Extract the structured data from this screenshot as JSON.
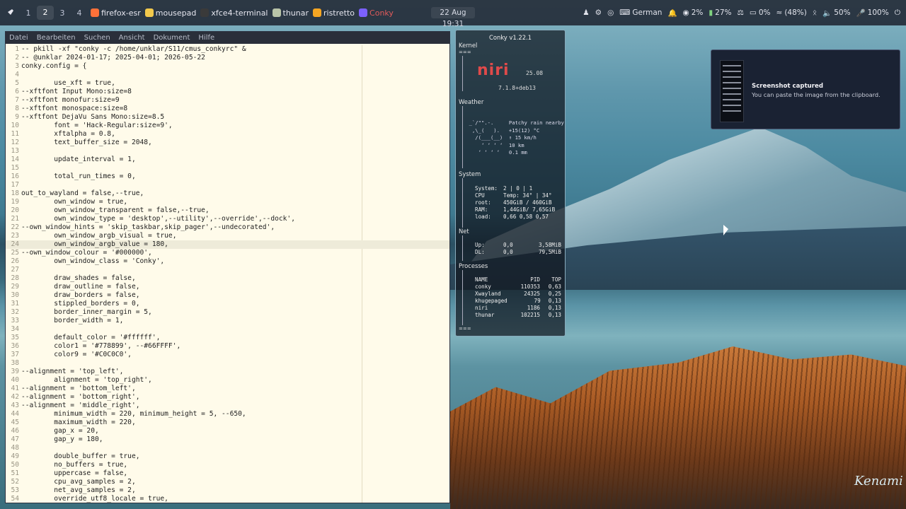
{
  "topbar": {
    "workspaces": [
      "1",
      "2",
      "3",
      "4"
    ],
    "active_workspace": "2",
    "apps": [
      {
        "label": "firefox-esr",
        "icon": "firefox-icon",
        "color": "#ff7139"
      },
      {
        "label": "mousepad",
        "icon": "mousepad-icon",
        "color": "#f2c94c"
      },
      {
        "label": "xfce4-terminal",
        "icon": "terminal-icon",
        "color": "#3a3a3a"
      },
      {
        "label": "thunar",
        "icon": "folder-icon",
        "color": "#b9c4a8"
      },
      {
        "label": "ristretto",
        "icon": "image-viewer-icon",
        "color": "#f5a623"
      },
      {
        "label": "Conky",
        "icon": "conky-icon",
        "color": "#7b61ff",
        "text_color": "#e05a5a"
      }
    ],
    "clock": "22 Aug 19:31",
    "tray": {
      "keyboard_layout": "German",
      "cpu": "2%",
      "battery": "27%",
      "backlight": "0%",
      "wifi": "(48%)",
      "volume": "50%",
      "mic": "100%"
    }
  },
  "editor": {
    "menu": [
      "Datei",
      "Bearbeiten",
      "Suchen",
      "Ansicht",
      "Dokument",
      "Hilfe"
    ],
    "highlight_line": 24,
    "lines": [
      "-- pkill -xf \"conky -c /home/unklar/S11/cmus_conkyrc\" &",
      "-- @unklar 2024-01-17; 2025-04-01; 2026-05-22",
      "conky.config = {",
      "",
      "        use_xft = true,",
      "--xftfont Input Mono:size=8",
      "--xftfont monofur:size=9",
      "--xftfont monospace:size=8",
      "--xftfont DejaVu Sans Mono:size=8.5",
      "        font = 'Hack-Regular:size=9',",
      "        xftalpha = 0.8,",
      "        text_buffer_size = 2048,",
      "",
      "        update_interval = 1,",
      "",
      "        total_run_times = 0,",
      "",
      "out_to_wayland = false,--true,",
      "        own_window = true,",
      "        own_window_transparent = false,--true,",
      "        own_window_type = 'desktop',--utility',--override',--dock',",
      "--own_window_hints = 'skip_taskbar,skip_pager',--undecorated',",
      "        own_window_argb_visual = true,",
      "        own_window_argb_value = 180,",
      "--own_window_colour = '#000000',",
      "        own_window_class = 'Conky',",
      "",
      "        draw_shades = false,",
      "        draw_outline = false,",
      "        draw_borders = false,",
      "        stippled_borders = 0,",
      "        border_inner_margin = 5,",
      "        border_width = 1,",
      "",
      "        default_color = '#ffffff',",
      "        color1 = '#778899', --#66FFFF',",
      "        color9 = '#C0C0C0',",
      "",
      "--alignment = 'top_left',",
      "        alignment = 'top_right',",
      "--alignment = 'bottom_left',",
      "--alignment = 'bottom_right',",
      "--alignment = 'middle_right',",
      "        minimum_width = 220, minimum_height = 5, --650,",
      "        maximum_width = 220,",
      "        gap_x = 20,",
      "        gap_y = 180,",
      "",
      "        double_buffer = true,",
      "        no_buffers = true,",
      "        uppercase = false,",
      "        cpu_avg_samples = 2,",
      "        net_avg_samples = 2,",
      "        override_utf8_locale = true,"
    ]
  },
  "conky": {
    "title": "Conky v1.22.1",
    "sections": {
      "kernel": "Kernel",
      "weather": "Weather",
      "system": "System",
      "net": "Net",
      "processes": "Processes"
    },
    "kernel_rule": "===",
    "logo_text": "niri",
    "niri_version": "25.08",
    "kernel_version": "7.1.8+deb13",
    "weather": [
      "  _`/\"\".-.     Patchy rain nearby",
      "   ,\\_(   ).   +15(12) °C",
      "    /(___(__)  ↑ 15 km/h",
      "      ‘ ‘ ‘ ‘  10 km",
      "     ‘ ‘ ‘ ‘   0.1 mm"
    ],
    "system": [
      [
        "System:",
        "2 | 0 | 1",
        ""
      ],
      [
        "CPU",
        "Temp: 34° | 34°",
        ""
      ],
      [
        "root:",
        "450GiB / 460GiB",
        ""
      ],
      [
        "RAM:",
        "1,44GiB/ 7,65GiB",
        ""
      ],
      [
        "load:",
        "0,66 0,58 0,57",
        ""
      ]
    ],
    "net": [
      [
        "Up:",
        "0,0",
        "3,58MiB"
      ],
      [
        "DL:",
        "0,0",
        "79,5MiB"
      ]
    ],
    "process_header": [
      "NAME",
      "PID",
      "TOP"
    ],
    "processes": [
      [
        "conky",
        "110353",
        "0,63"
      ],
      [
        "Xwayland",
        "24325",
        "0,25"
      ],
      [
        "khugepaged",
        "79",
        "0,13"
      ],
      [
        "niri",
        "1186",
        "0,13"
      ],
      [
        "thunar",
        "102215",
        "0,13"
      ]
    ],
    "end_rule": "==="
  },
  "notification": {
    "title": "Screenshot captured",
    "body": "You can paste the image from the clipboard."
  },
  "wallpaper_signature": "Kenami"
}
